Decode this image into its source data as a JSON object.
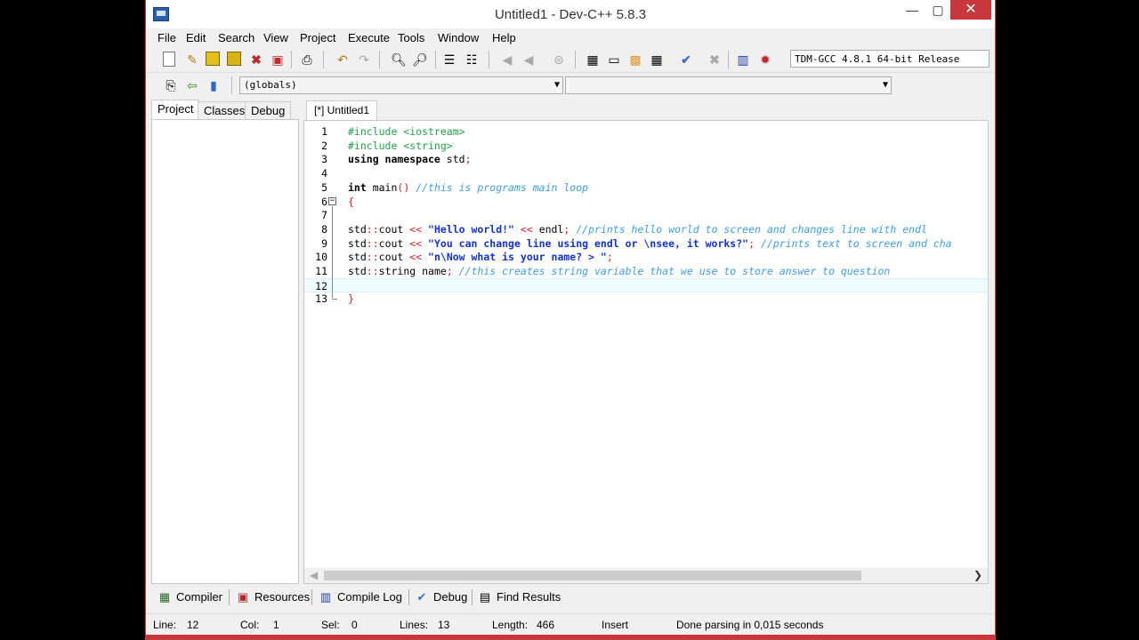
{
  "window": {
    "title": "Untitled1 - Dev-C++ 5.8.3"
  },
  "titlebar_buttons": {
    "minimize": "—",
    "maximize": "▢",
    "close": "✕"
  },
  "menu": [
    "File",
    "Edit",
    "Search",
    "View",
    "Project",
    "Execute",
    "Tools",
    "Window",
    "Help"
  ],
  "toolbar": {
    "compiler": "TDM-GCC 4.8.1 64-bit Release"
  },
  "combos": {
    "scope": "(globals)",
    "member": ""
  },
  "left_tabs": [
    "Project",
    "Classes",
    "Debug"
  ],
  "editor": {
    "tab_label": "[*] Untitled1",
    "lines": [
      {
        "n": "1",
        "tokens": [
          {
            "c": "pp",
            "t": "#include <iostream>"
          }
        ]
      },
      {
        "n": "2",
        "tokens": [
          {
            "c": "pp",
            "t": "#include <string>"
          }
        ]
      },
      {
        "n": "3",
        "tokens": [
          {
            "c": "kw",
            "t": "using namespace "
          },
          {
            "c": "txt",
            "t": "std"
          },
          {
            "c": "op",
            "t": ";"
          }
        ]
      },
      {
        "n": "4",
        "tokens": []
      },
      {
        "n": "5",
        "tokens": [
          {
            "c": "kw",
            "t": "int "
          },
          {
            "c": "txt",
            "t": "main"
          },
          {
            "c": "op",
            "t": "() "
          },
          {
            "c": "cm",
            "t": "//this is programs main loop"
          }
        ]
      },
      {
        "n": "6",
        "tokens": [
          {
            "c": "op",
            "t": "{"
          }
        ]
      },
      {
        "n": "7",
        "tokens": []
      },
      {
        "n": "8",
        "tokens": [
          {
            "c": "txt",
            "t": "std"
          },
          {
            "c": "op",
            "t": "::"
          },
          {
            "c": "txt",
            "t": "cout "
          },
          {
            "c": "op",
            "t": "<< "
          },
          {
            "c": "str",
            "t": "\"Hello world!\""
          },
          {
            "c": "op",
            "t": " << "
          },
          {
            "c": "txt",
            "t": "endl"
          },
          {
            "c": "op",
            "t": "; "
          },
          {
            "c": "cm",
            "t": "//prints hello world to screen and changes line with endl"
          }
        ]
      },
      {
        "n": "9",
        "tokens": [
          {
            "c": "txt",
            "t": "std"
          },
          {
            "c": "op",
            "t": "::"
          },
          {
            "c": "txt",
            "t": "cout "
          },
          {
            "c": "op",
            "t": "<< "
          },
          {
            "c": "str",
            "t": "\"You can change line using endl or \\nsee, it works?\""
          },
          {
            "c": "op",
            "t": "; "
          },
          {
            "c": "cm",
            "t": "//prints text to screen and cha"
          }
        ]
      },
      {
        "n": "10",
        "tokens": [
          {
            "c": "txt",
            "t": "std"
          },
          {
            "c": "op",
            "t": "::"
          },
          {
            "c": "txt",
            "t": "cout "
          },
          {
            "c": "op",
            "t": "<< "
          },
          {
            "c": "str",
            "t": "\"n\\Now what is your name? > \""
          },
          {
            "c": "op",
            "t": ";"
          }
        ]
      },
      {
        "n": "11",
        "tokens": [
          {
            "c": "txt",
            "t": "std"
          },
          {
            "c": "op",
            "t": "::"
          },
          {
            "c": "txt",
            "t": "string name"
          },
          {
            "c": "op",
            "t": "; "
          },
          {
            "c": "cm",
            "t": "//this creates string variable that we use to store answer to question"
          }
        ]
      },
      {
        "n": "12",
        "tokens": []
      },
      {
        "n": "13",
        "tokens": [
          {
            "c": "op",
            "t": "}"
          }
        ]
      }
    ]
  },
  "bottom_tabs": [
    "Compiler",
    "Resources",
    "Compile Log",
    "Debug",
    "Find Results"
  ],
  "status": {
    "line_label": "Line:",
    "line": "12",
    "col_label": "Col:",
    "col": "1",
    "sel_label": "Sel:",
    "sel": "0",
    "lines_label": "Lines:",
    "lines": "13",
    "length_label": "Length:",
    "length": "466",
    "mode": "Insert",
    "message": "Done parsing in 0,015 seconds"
  }
}
